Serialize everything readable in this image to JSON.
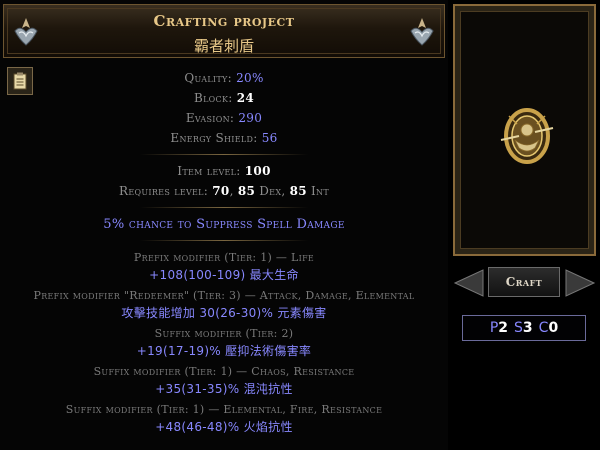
{
  "header": {
    "title": "Crafting project",
    "subtitle": "霸者刺盾"
  },
  "properties": {
    "quality_label": "Quality:",
    "quality_value": "20%",
    "block_label": "Block:",
    "block_value": "24",
    "evasion_label": "Evasion:",
    "evasion_value": "290",
    "energy_shield_label": "Energy Shield:",
    "energy_shield_value": "56"
  },
  "requirements": {
    "item_level_label": "Item level:",
    "item_level_value": "100",
    "requires_label": "Requires level:",
    "level_value": "70",
    "dex_value": "85",
    "dex_label": "Dex,",
    "int_value": "85",
    "int_label": "Int"
  },
  "implicit": "5% chance to Suppress Spell Damage",
  "modifiers": [
    {
      "header": "Prefix modifier (Tier: 1) — Life",
      "value": "+108(100-109) 最大生命"
    },
    {
      "header": "Prefix modifier \"Redeemer\" (Tier: 3) — Attack, Damage, Elemental",
      "value": "攻擊技能增加 30(26-30)% 元素傷害"
    },
    {
      "header": "Suffix modifier (Tier: 2)",
      "value": "+19(17-19)% 壓抑法術傷害率"
    },
    {
      "header": "Suffix modifier (Tier: 1) — Chaos, Resistance",
      "value": "+35(31-35)% 混沌抗性"
    },
    {
      "header": "Suffix modifier (Tier: 1) — Elemental, Fire, Resistance",
      "value": "+48(46-48)% 火焰抗性"
    }
  ],
  "craft_button": "Craft",
  "sockets": {
    "p_label": "P",
    "p_value": "2",
    "s_label": "S",
    "s_value": "3",
    "c_label": "C",
    "c_value": "0"
  },
  "icons": {
    "header_left": "winged-emblem-icon",
    "header_right": "winged-emblem-icon",
    "clipboard": "clipboard-icon",
    "item": "shield-item-icon"
  },
  "colors": {
    "magic_blue": "#8888ff",
    "title_gold": "#e8c888",
    "label_grey": "#8f8f8f"
  }
}
